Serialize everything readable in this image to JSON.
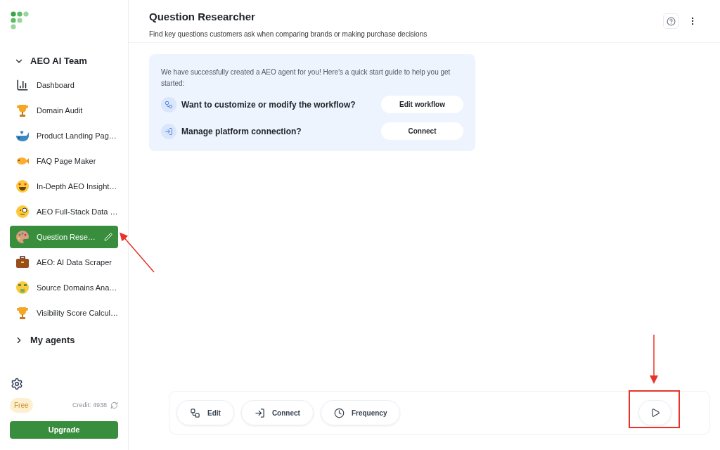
{
  "sidebar": {
    "groups": [
      {
        "label": "AEO AI Team",
        "expanded": true,
        "items": [
          {
            "label": "Dashboard",
            "selected": false
          },
          {
            "label": "Domain Audit",
            "selected": false
          },
          {
            "label": "Product Landing Pag…",
            "selected": false
          },
          {
            "label": "FAQ Page Maker",
            "selected": false
          },
          {
            "label": "In-Depth AEO Insight…",
            "selected": false
          },
          {
            "label": "AEO Full-Stack Data …",
            "selected": false
          },
          {
            "label": "Question Rese…",
            "selected": true
          },
          {
            "label": "AEO: AI Data Scraper",
            "selected": false
          },
          {
            "label": "Source Domains Ana…",
            "selected": false
          },
          {
            "label": "Visibility Score Calcul…",
            "selected": false
          }
        ]
      },
      {
        "label": "My agents",
        "expanded": false
      }
    ],
    "plan_badge": "Free",
    "credit": "Credit: 4938",
    "upgrade_button": "Upgrade"
  },
  "header": {
    "title": "Question Researcher",
    "subtitle": "Find key questions customers ask when comparing brands or making purchase decisions"
  },
  "guide": {
    "intro": "We have successfully created a AEO agent for you! Here's a quick start guide to help you get started:",
    "rows": [
      {
        "kind": "workflow",
        "question": "Want to customize or modify the workflow?",
        "button": "Edit workflow"
      },
      {
        "kind": "connect",
        "question": "Manage platform connection?",
        "button": "Connect"
      }
    ]
  },
  "toolbar": {
    "buttons": [
      {
        "kind": "workflow",
        "label": "Edit"
      },
      {
        "kind": "connect",
        "label": "Connect"
      },
      {
        "kind": "clock",
        "label": "Frequency"
      }
    ]
  }
}
